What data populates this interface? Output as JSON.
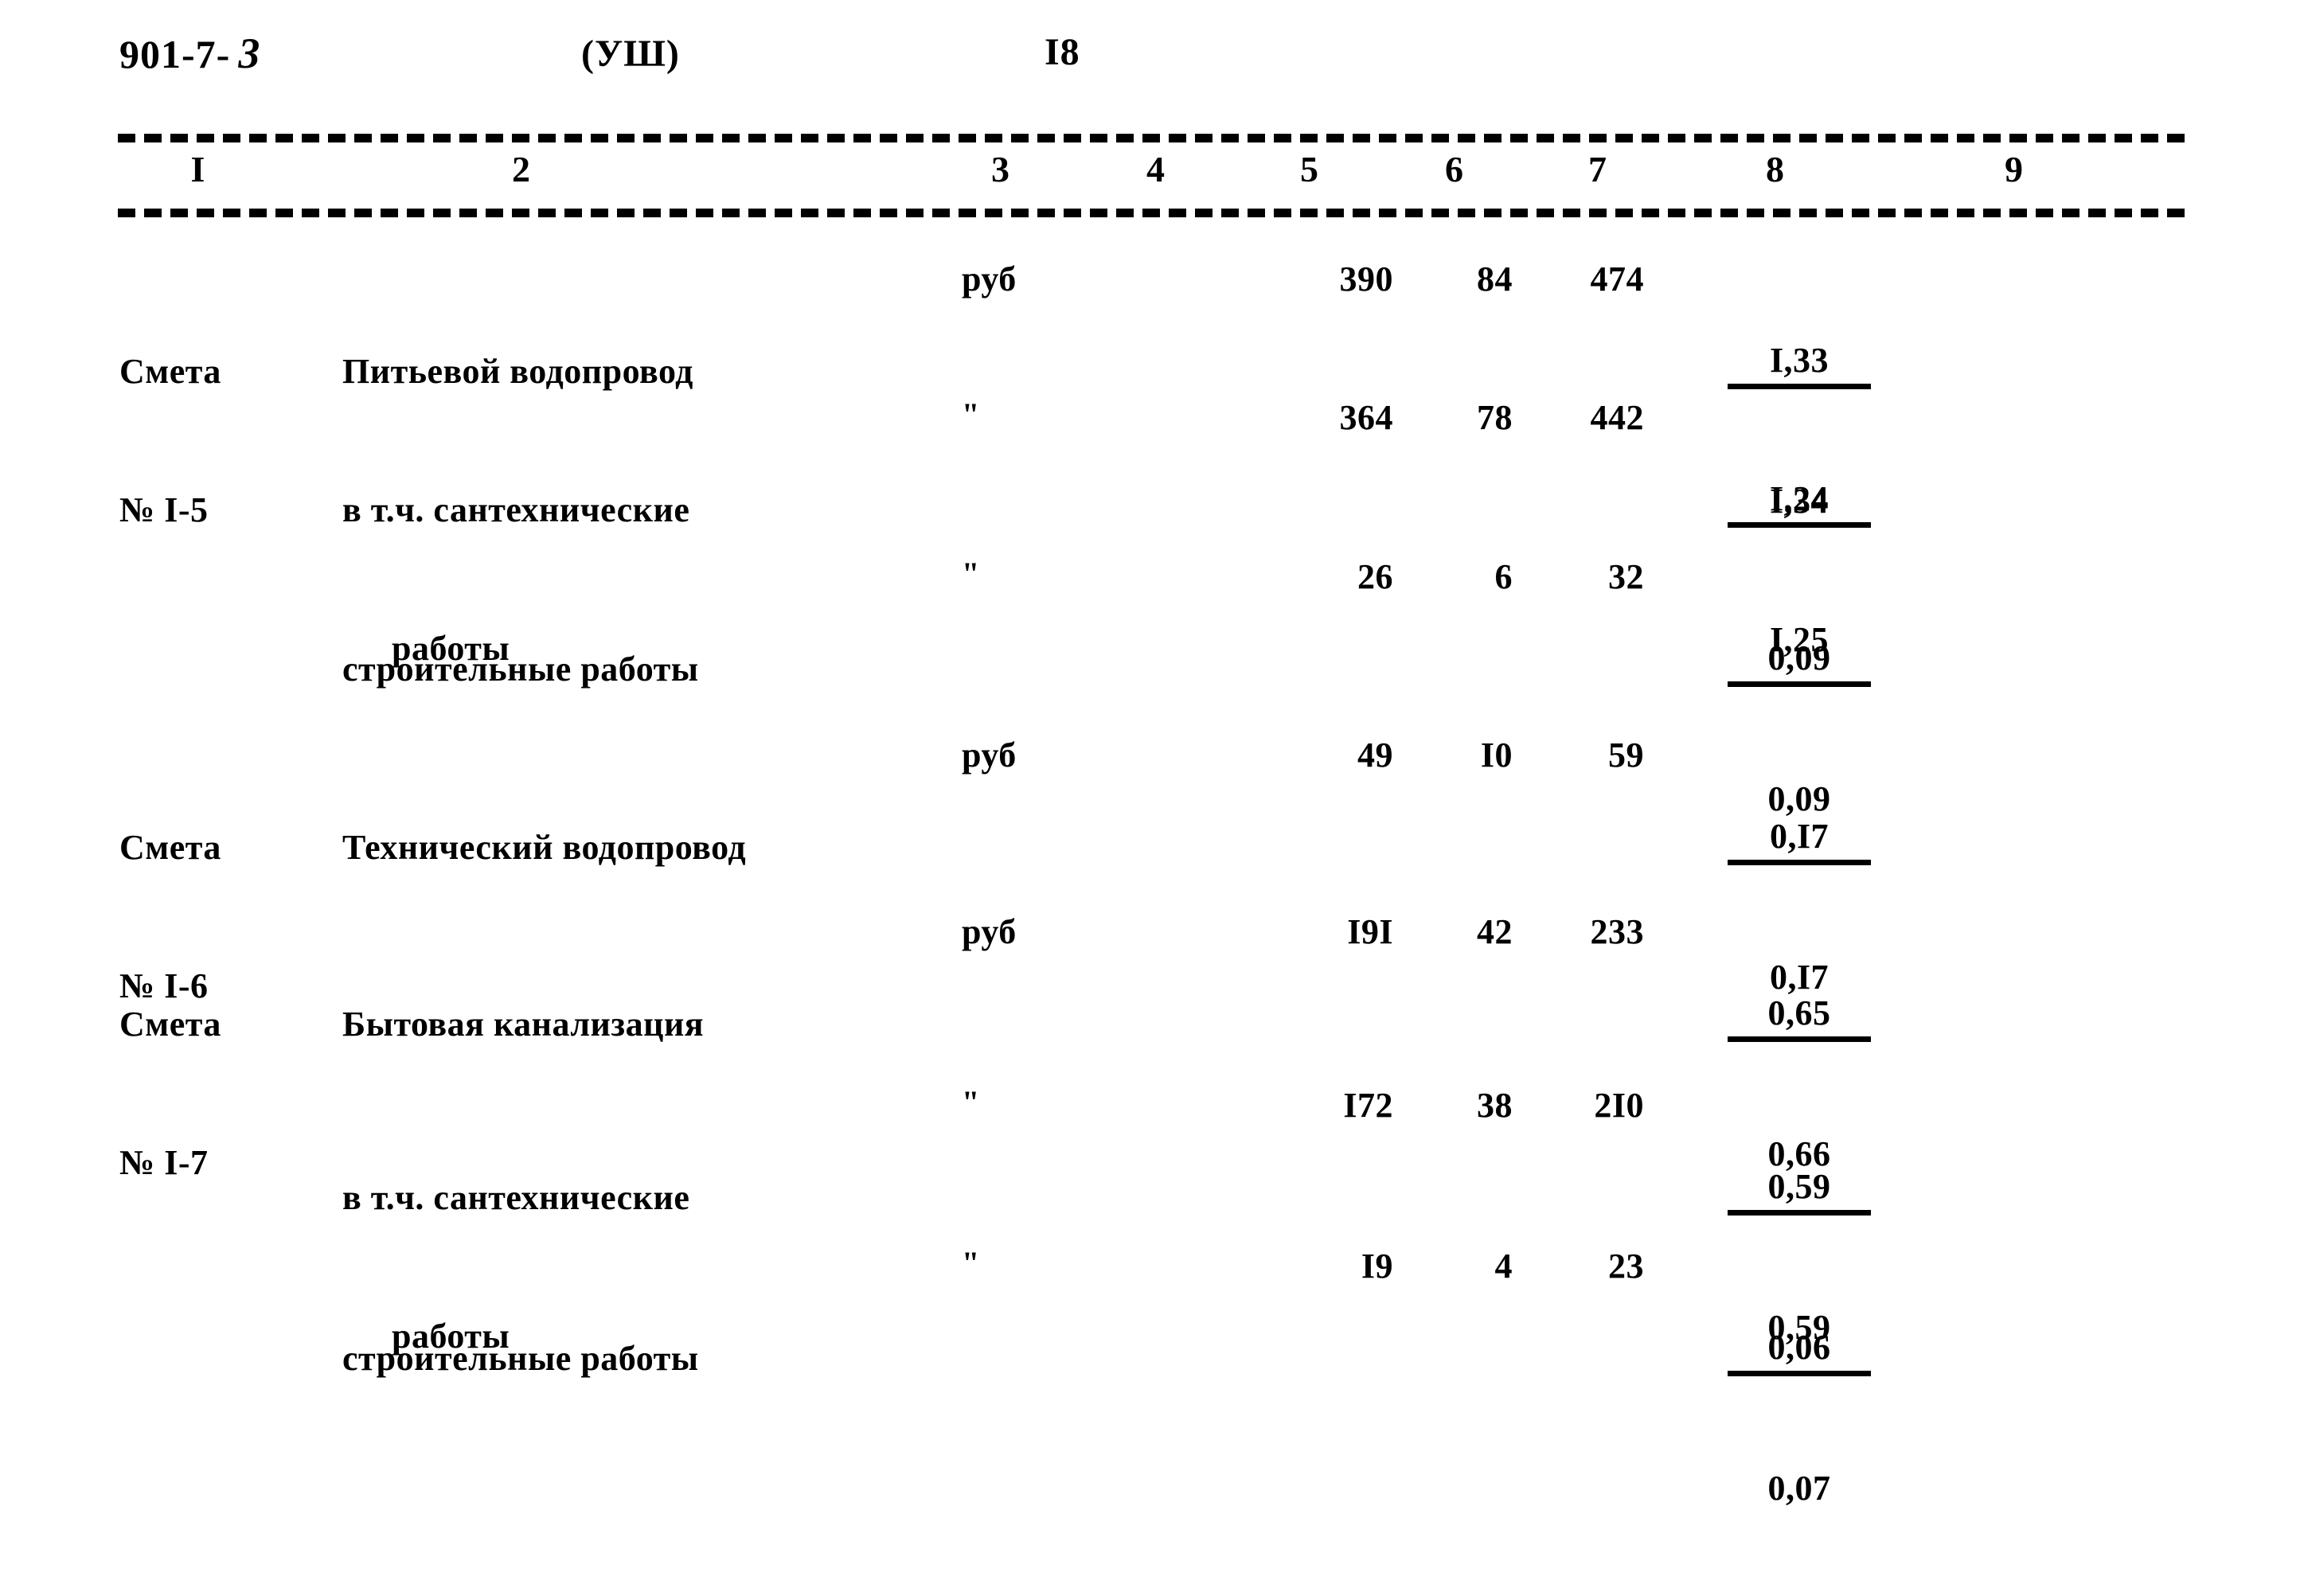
{
  "header": {
    "doc_code_prefix": "901-7-",
    "doc_code_hand": "3",
    "series": "(УШ)",
    "page_number": "I8"
  },
  "table": {
    "column_numbers": [
      "I",
      "2",
      "3",
      "4",
      "5",
      "6",
      "7",
      "8",
      "9"
    ],
    "rows": [
      {
        "estimate_line1": "Смета",
        "estimate_line2": "№ I-5",
        "name_line1": "Питьевой водопровод",
        "name_line2": "",
        "unit": "руб",
        "col5": "390",
        "col6": "84",
        "col7": "474",
        "col8_num": "I,33",
        "col8_den": "I,34"
      },
      {
        "estimate_line1": "",
        "estimate_line2": "",
        "name_line1": "в т.ч. сантехнические",
        "name_line2": "работы",
        "unit": "\"",
        "col5": "364",
        "col6": "78",
        "col7": "442",
        "col8_num": "I,24",
        "col8_den": "I,25"
      },
      {
        "estimate_line1": "",
        "estimate_line2": "",
        "name_line1": "строительные работы",
        "name_line2": "",
        "unit": "\"",
        "col5": "26",
        "col6": "6",
        "col7": "32",
        "col8_num": "0,09",
        "col8_den": "0,09"
      },
      {
        "estimate_line1": "Смета",
        "estimate_line2": "№ I-6",
        "name_line1": "Технический водопровод",
        "name_line2": "",
        "unit": "руб",
        "col5": "49",
        "col6": "I0",
        "col7": "59",
        "col8_num": "0,I7",
        "col8_den": "0,I7"
      },
      {
        "estimate_line1": "Смета",
        "estimate_line2": "№ I-7",
        "name_line1": "Бытовая канализация",
        "name_line2": "",
        "unit": "руб",
        "col5": "I9I",
        "col6": "42",
        "col7": "233",
        "col8_num": "0,65",
        "col8_den": "0,66"
      },
      {
        "estimate_line1": "",
        "estimate_line2": "",
        "name_line1": "в т.ч. сантехнические",
        "name_line2": "работы",
        "unit": "\"",
        "col5": "I72",
        "col6": "38",
        "col7": "2I0",
        "col8_num": "0,59",
        "col8_den": "0,59"
      },
      {
        "estimate_line1": "",
        "estimate_line2": "",
        "name_line1": "строительные работы",
        "name_line2": "",
        "unit": "\"",
        "col5": "I9",
        "col6": "4",
        "col7": "23",
        "col8_num": "0,06",
        "col8_den": "0,07"
      }
    ]
  }
}
